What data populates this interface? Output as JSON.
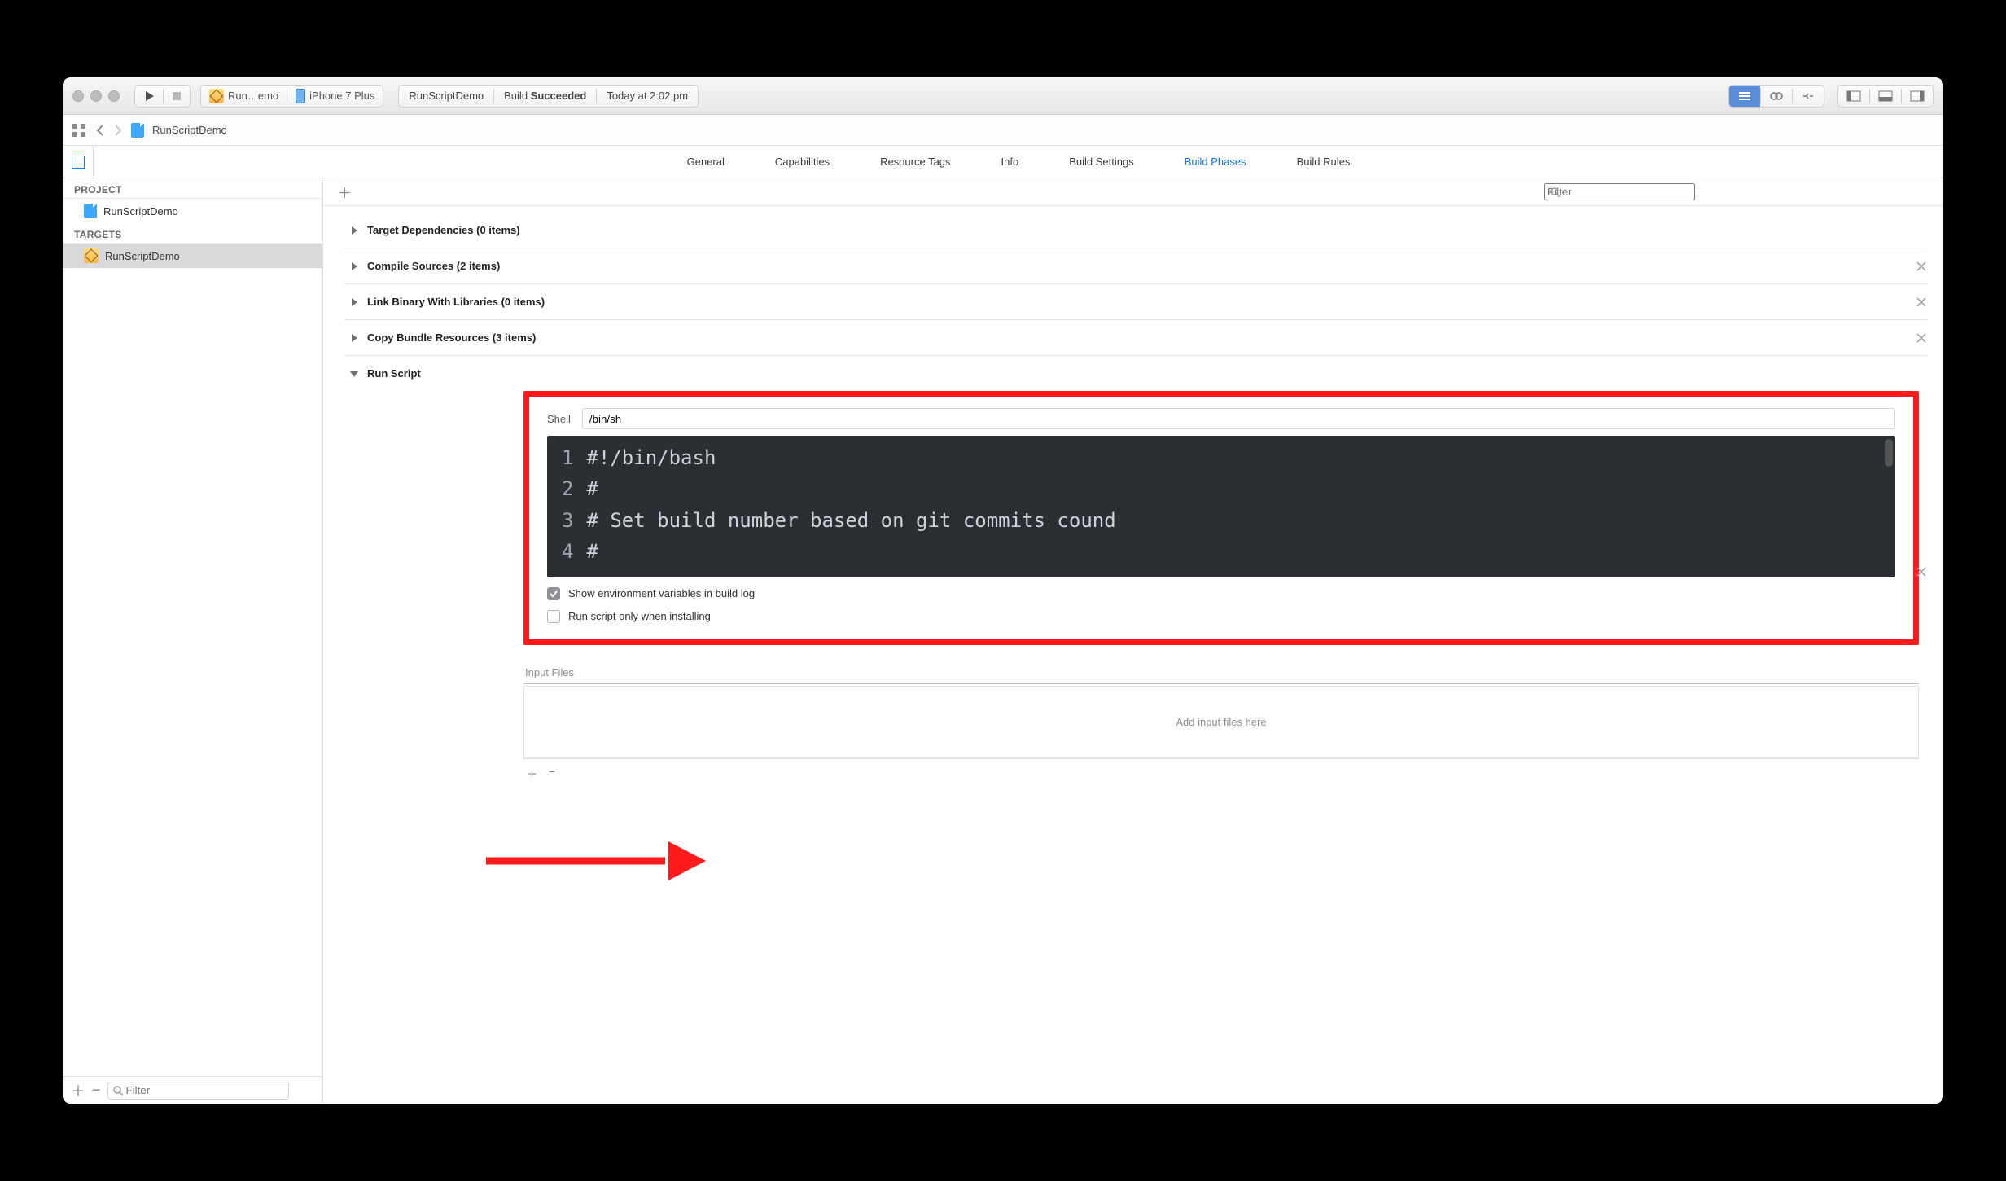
{
  "toolbar": {
    "scheme": "Run…emo",
    "device": "iPhone 7 Plus",
    "status_project": "RunScriptDemo",
    "status_build_prefix": "Build ",
    "status_build_bold": "Succeeded",
    "status_time": "Today at 2:02 pm"
  },
  "pathbar": {
    "file": "RunScriptDemo"
  },
  "tabs": {
    "items": [
      "General",
      "Capabilities",
      "Resource Tags",
      "Info",
      "Build Settings",
      "Build Phases",
      "Build Rules"
    ],
    "active_index": 5
  },
  "sidebar": {
    "project_header": "PROJECT",
    "project_item": "RunScriptDemo",
    "targets_header": "TARGETS",
    "target_item": "RunScriptDemo",
    "filter_placeholder": "Filter"
  },
  "editor_toolbar": {
    "filter_placeholder": "Filter"
  },
  "phases": [
    {
      "title": "Target Dependencies (0 items)",
      "expanded": false,
      "removable": false
    },
    {
      "title": "Compile Sources (2 items)",
      "expanded": false,
      "removable": true
    },
    {
      "title": "Link Binary With Libraries (0 items)",
      "expanded": false,
      "removable": true
    },
    {
      "title": "Copy Bundle Resources (3 items)",
      "expanded": false,
      "removable": true
    },
    {
      "title": "Run Script",
      "expanded": true,
      "removable": true
    }
  ],
  "run_script": {
    "shell_label": "Shell",
    "shell_value": "/bin/sh",
    "code_lines": [
      "#!/bin/bash",
      "#",
      "# Set build number based on git commits cound",
      "#"
    ],
    "opt_env_checked": true,
    "opt_env_label": "Show environment variables in build log",
    "opt_install_checked": false,
    "opt_install_label": "Run script only when installing",
    "input_files_header": "Input Files",
    "input_files_placeholder": "Add input files here"
  }
}
